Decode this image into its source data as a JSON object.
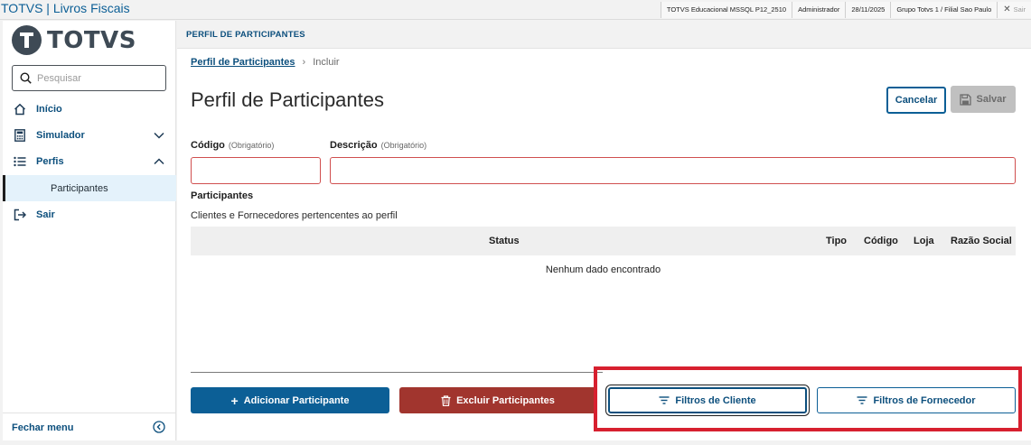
{
  "app_title": "TOTVS | Livros Fiscais",
  "info_bar": {
    "environment": "TOTVS Educacional MSSQL P12_2510",
    "user": "Administrador",
    "date": "28/11/2025",
    "branch": "Grupo Totvs 1 / Filial Sao Paulo",
    "exit_label": "Sair"
  },
  "sidebar": {
    "logo_text": "TOTVS",
    "search_placeholder": "Pesquisar",
    "items": [
      {
        "label": "Início",
        "icon": "home-icon"
      },
      {
        "label": "Simulador",
        "icon": "calculator-icon",
        "chevron": "down"
      },
      {
        "label": "Perfis",
        "icon": "list-icon",
        "chevron": "up"
      },
      {
        "label": "Participantes",
        "selected": true
      },
      {
        "label": "Sair",
        "icon": "logout-icon"
      }
    ],
    "footer_label": "Fechar menu"
  },
  "header": {
    "section_title": "PERFIL DE PARTICIPANTES"
  },
  "breadcrumb": {
    "link": "Perfil de Participantes",
    "current": "Incluir"
  },
  "page_title": "Perfil de Participantes",
  "actions": {
    "cancel": "Cancelar",
    "save": "Salvar"
  },
  "form": {
    "codigo_label": "Código",
    "codigo_required": "(Obrigatório)",
    "codigo_value": "",
    "descricao_label": "Descrição",
    "descricao_required": "(Obrigatório)",
    "descricao_value": ""
  },
  "participants": {
    "title": "Participantes",
    "subtitle": "Clientes e Fornecedores pertencentes ao perfil",
    "columns": [
      "Status",
      "Tipo",
      "Código",
      "Loja",
      "Razão Social"
    ],
    "empty_text": "Nenhum dado encontrado"
  },
  "buttons": {
    "add": "Adicionar Participante",
    "delete": "Excluir Participantes",
    "filter_client": "Filtros de Cliente",
    "filter_supplier": "Filtros de Fornecedor"
  },
  "colors": {
    "primary": "#0c5f96",
    "danger": "#a1352e",
    "highlight": "#d7202f"
  }
}
